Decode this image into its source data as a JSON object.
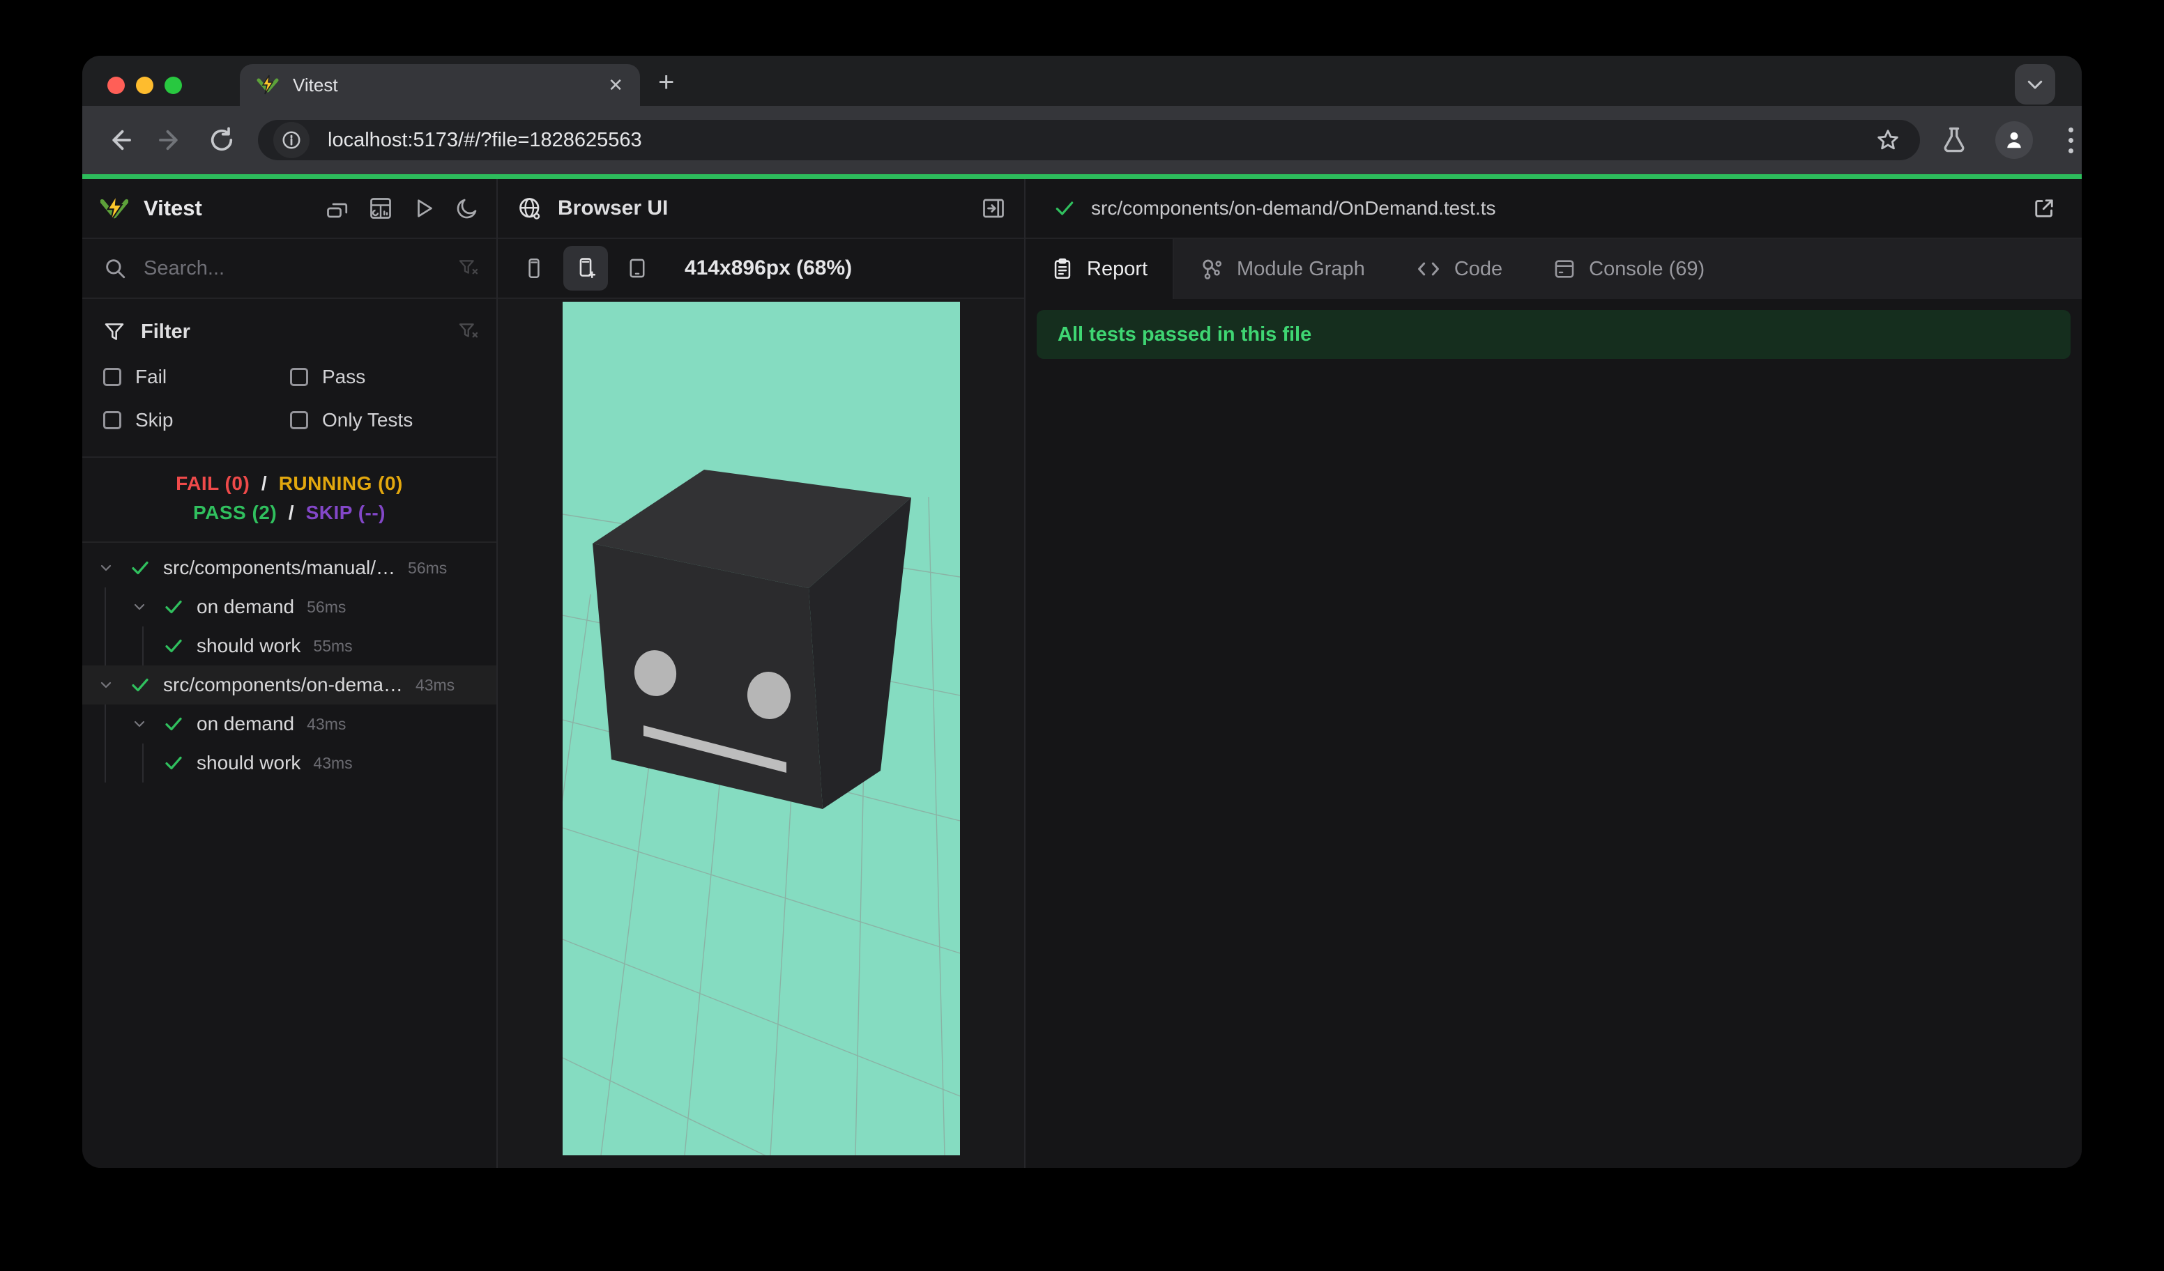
{
  "chrome": {
    "tab_title": "Vitest",
    "close_glyph": "✕",
    "newtab_glyph": "+",
    "url": "localhost:5173/#/?file=1828625563"
  },
  "sidebar": {
    "app_name": "Vitest",
    "search_placeholder": "Search...",
    "filter_title": "Filter",
    "filters": [
      {
        "label": "Fail",
        "checked": false
      },
      {
        "label": "Pass",
        "checked": false
      },
      {
        "label": "Skip",
        "checked": false
      },
      {
        "label": "Only Tests",
        "checked": false
      }
    ],
    "stats": {
      "fail": {
        "text": "FAIL (0)",
        "color": "#ef4a4a"
      },
      "running": {
        "text": "RUNNING (0)",
        "color": "#e2a70e"
      },
      "pass": {
        "text": "PASS (2)",
        "color": "#30c05e"
      },
      "skip": {
        "text": "SKIP (--)",
        "color": "#8347c8"
      },
      "separator": "/"
    },
    "tree": [
      {
        "label": "src/components/manual/…",
        "duration": "56ms",
        "depth": 0,
        "status": "pass"
      },
      {
        "label": "on demand",
        "duration": "56ms",
        "depth": 1,
        "status": "pass"
      },
      {
        "label": "should work",
        "duration": "55ms",
        "depth": 2,
        "status": "pass"
      },
      {
        "label": "src/components/on-dema…",
        "duration": "43ms",
        "depth": 0,
        "status": "pass",
        "selected": true
      },
      {
        "label": "on demand",
        "duration": "43ms",
        "depth": 1,
        "status": "pass"
      },
      {
        "label": "should work",
        "duration": "43ms",
        "depth": 2,
        "status": "pass"
      }
    ]
  },
  "preview": {
    "title": "Browser UI",
    "viewport_label": "414x896px (68%)",
    "scene": {
      "background_color": "#85dcc1",
      "cube_front_color": "#2b2b2d",
      "cube_top_color": "#323234",
      "cube_side_color": "#242427",
      "face_feature_color": "#b6b6b6"
    }
  },
  "report": {
    "file_path": "src/components/on-demand/OnDemand.test.ts",
    "file_status_color": "#30c05e",
    "tabs": [
      {
        "label": "Report",
        "active": true
      },
      {
        "label": "Module Graph",
        "active": false
      },
      {
        "label": "Code",
        "active": false
      },
      {
        "label": "Console (69)",
        "active": false
      }
    ],
    "banner": {
      "text": "All tests passed in this file",
      "text_color": "#3fd673",
      "background": "#152e1e"
    }
  },
  "theme": {
    "progress_color": "#2dbc5c"
  }
}
